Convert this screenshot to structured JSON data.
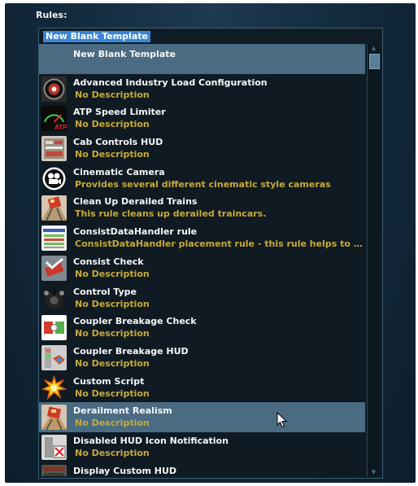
{
  "panel": {
    "label": "Rules:",
    "name_value": "New Blank Template"
  },
  "list": {
    "selected_index": 12,
    "items": [
      {
        "title": "New Blank Template",
        "desc": "",
        "icon": "blank-icon"
      },
      {
        "title": "Advanced Industry Load Configuration",
        "desc": "No Description",
        "icon": "gauge-icon"
      },
      {
        "title": "ATP Speed Limiter",
        "desc": "No Description",
        "icon": "atp-speedometer-icon"
      },
      {
        "title": "Cab Controls HUD",
        "desc": "No Description",
        "icon": "cab-controls-icon"
      },
      {
        "title": "Cinematic Camera",
        "desc": "Provides several different cinematic style cameras",
        "icon": "film-camera-icon"
      },
      {
        "title": "Clean Up Derailed Trains",
        "desc": "This rule cleans up derailed traincars.",
        "icon": "derailed-train-icon"
      },
      {
        "title": "ConsistDataHandler rule",
        "desc": "ConsistDataHandler placement rule - this rule helps to place o...",
        "icon": "consist-data-icon"
      },
      {
        "title": "Consist Check",
        "desc": "No Description",
        "icon": "consist-check-icon"
      },
      {
        "title": "Control Type",
        "desc": "No Description",
        "icon": "control-type-icon"
      },
      {
        "title": "Coupler Breakage Check",
        "desc": "No Description",
        "icon": "coupler-check-icon"
      },
      {
        "title": "Coupler Breakage HUD",
        "desc": "No Description",
        "icon": "coupler-hud-icon"
      },
      {
        "title": "Custom Script",
        "desc": "No Description",
        "icon": "explosion-icon"
      },
      {
        "title": "Derailment Realism",
        "desc": "No Description",
        "icon": "derailment-icon"
      },
      {
        "title": "Disabled HUD Icon Notification",
        "desc": "No Description",
        "icon": "disabled-hud-icon"
      },
      {
        "title": "Display Custom HUD",
        "desc": "",
        "icon": "custom-hud-icon"
      }
    ]
  },
  "colors": {
    "selected_row": "#4a6b82",
    "description_text": "#c6a93a",
    "input_highlight": "#3a86d6"
  }
}
